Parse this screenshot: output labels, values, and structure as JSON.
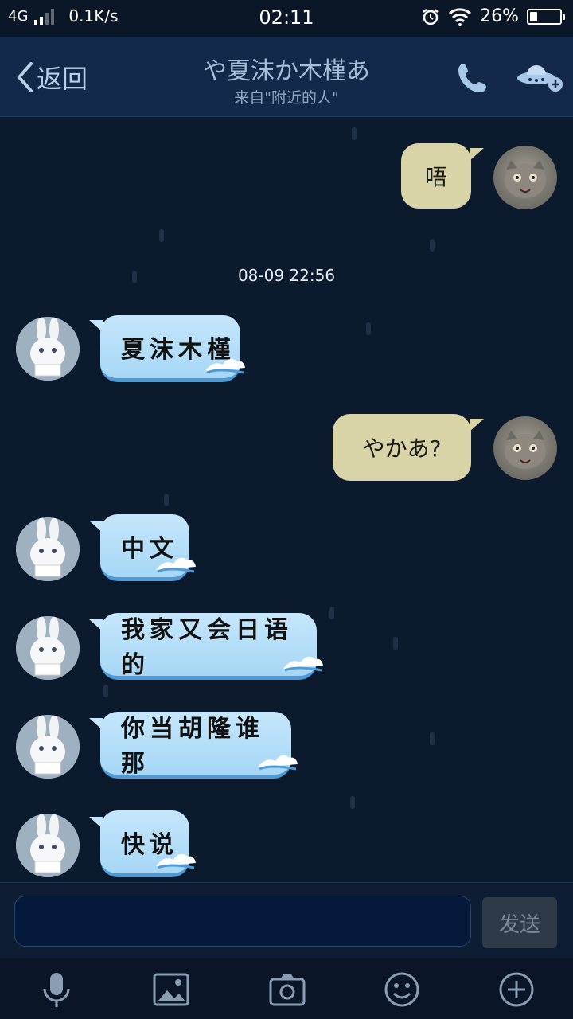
{
  "status_bar": {
    "network": "4G",
    "speed": "0.1K/s",
    "time": "02:11",
    "battery_percent": "26%",
    "battery_level": 0.26
  },
  "header": {
    "back_label": "返回",
    "title": "や夏沫か木槿あ",
    "subtitle": "来自\"附近的人\""
  },
  "messages": [
    {
      "side": "out",
      "text": "唔"
    },
    {
      "side": "out",
      "text": "やかあ?"
    },
    {
      "side": "in",
      "text": "夏沫木槿"
    },
    {
      "side": "in",
      "text": "中文"
    },
    {
      "side": "in",
      "text": "我家又会日语的"
    },
    {
      "side": "in",
      "text": "你当胡隆谁那"
    },
    {
      "side": "in",
      "text": "快说"
    }
  ],
  "timestamp": "08-09 22:56",
  "composer": {
    "placeholder": "",
    "send_label": "发送"
  },
  "toolbar_icons": [
    "microphone-icon",
    "image-icon",
    "camera-icon",
    "emoji-icon",
    "plus-icon"
  ],
  "colors": {
    "background": "#0c1a2e",
    "outgoing_bubble": "#d9d4a8",
    "incoming_bubble": "#c5e6fb",
    "header": "#13294a"
  }
}
